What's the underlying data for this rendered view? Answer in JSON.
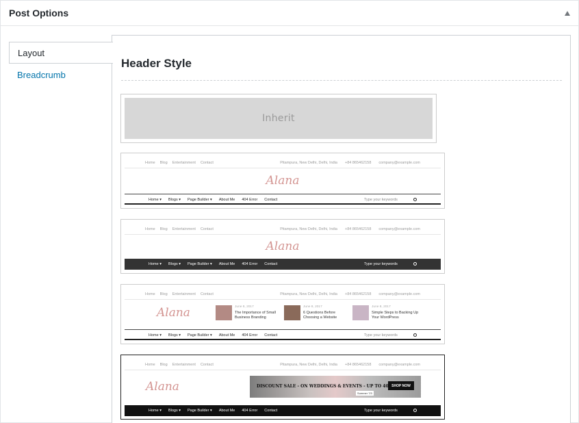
{
  "panel": {
    "title": "Post Options"
  },
  "tabs": [
    {
      "label": "Layout",
      "active": true
    },
    {
      "label": "Breadcrumb",
      "active": false
    }
  ],
  "section": {
    "title": "Header Style"
  },
  "topbar": {
    "links": [
      "Home",
      "Blog",
      "Entertainment",
      "Contact"
    ],
    "address": "Pitampura, New Delhi, Delhi, India",
    "phone": "+84 865462158",
    "email": "company@example.com"
  },
  "logo_text": "Alana",
  "nav": {
    "items": [
      "Home ▾",
      "Blogs ▾",
      "Page Builder ▾",
      "About Me",
      "404 Error",
      "Contact"
    ],
    "search_placeholder": "Type your keywords"
  },
  "options": [
    {
      "name": "inherit",
      "label": "Inherit"
    },
    {
      "name": "header-style-1"
    },
    {
      "name": "header-style-2"
    },
    {
      "name": "header-style-3"
    },
    {
      "name": "header-style-4",
      "selected": true
    }
  ],
  "posts": [
    {
      "date": "June 8, 2017",
      "title": "The Importance of Small Business Branding",
      "thumb_color": "#b38a84"
    },
    {
      "date": "June 8, 2017",
      "title": "6 Questions Before Choosing a Website",
      "thumb_color": "#8a6a5a"
    },
    {
      "date": "June 8, 2017",
      "title": "Simple Steps to Backing Up Your WordPress",
      "thumb_color": "#c9b5c5"
    }
  ],
  "banner": {
    "text": "DISCOUNT SALE - ON WEDDINGS & EVENTS - UP TO 40% OFF",
    "button": "SHOP NOW",
    "tag": "Summer 7/3"
  },
  "colors": {
    "accent_link": "#0073aa",
    "logo": "#d39491",
    "dark_nav": "#333333"
  }
}
